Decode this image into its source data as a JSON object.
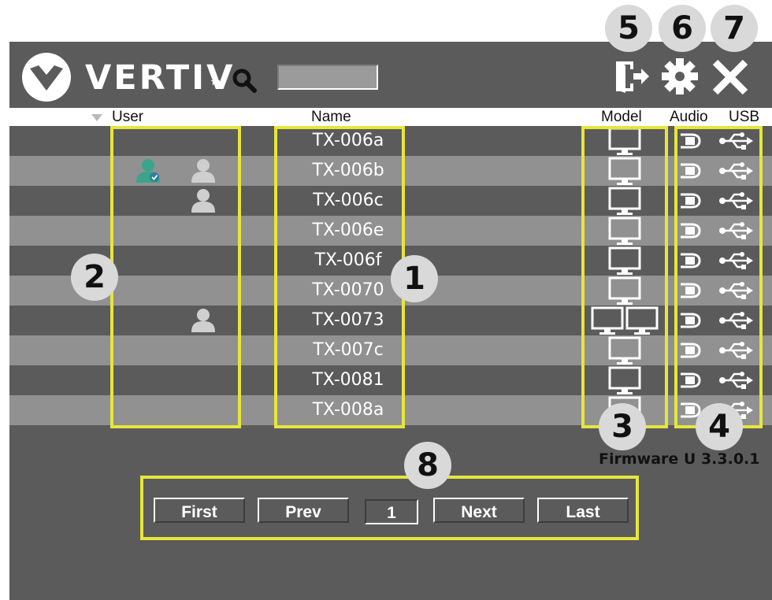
{
  "brand": {
    "name": "VERTIV",
    "tm": "TM"
  },
  "search": {
    "value": ""
  },
  "columns": {
    "user": "User",
    "name": "Name",
    "model": "Model",
    "audio": "Audio",
    "usb": "USB"
  },
  "toolbar": {
    "logout": "logout-icon",
    "settings": "gear-icon",
    "close": "close-icon"
  },
  "rows": [
    {
      "name": "TX-006a",
      "users": [],
      "model": "single"
    },
    {
      "name": "TX-006b",
      "users": [
        "active",
        "idle"
      ],
      "model": "single"
    },
    {
      "name": "TX-006c",
      "users": [
        "idle"
      ],
      "model": "single"
    },
    {
      "name": "TX-006e",
      "users": [],
      "model": "single"
    },
    {
      "name": "TX-006f",
      "users": [],
      "model": "single"
    },
    {
      "name": "TX-0070",
      "users": [],
      "model": "single"
    },
    {
      "name": "TX-0073",
      "users": [
        "idle"
      ],
      "model": "dual"
    },
    {
      "name": "TX-007c",
      "users": [],
      "model": "single"
    },
    {
      "name": "TX-0081",
      "users": [],
      "model": "single"
    },
    {
      "name": "TX-008a",
      "users": [],
      "model": "single"
    }
  ],
  "markers": [
    "1",
    "2",
    "3",
    "4",
    "5",
    "6",
    "7",
    "8"
  ],
  "pagination": {
    "first": "First",
    "prev": "Prev",
    "page": "1",
    "next": "Next",
    "last": "Last"
  },
  "firmware": "Firmware U 3.3.0.1",
  "colors": {
    "panel": "#5b5b5b",
    "row_light": "#919191",
    "highlight": "#e6e63c",
    "active_user": "#3aa58a",
    "idle_user": "#cfcfcf"
  }
}
